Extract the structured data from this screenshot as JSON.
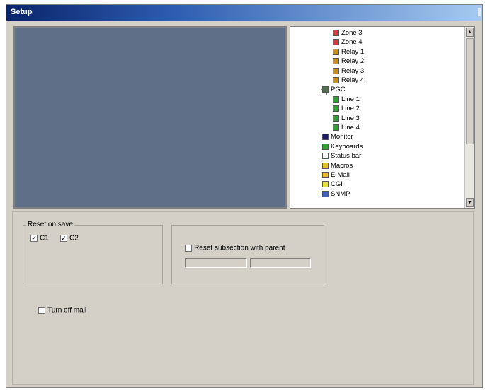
{
  "window": {
    "title": "Setup"
  },
  "tree": {
    "items": [
      {
        "label": "Zone 3",
        "icon": "zone-icon",
        "color": "#c84040",
        "indent": 2
      },
      {
        "label": "Zone 4",
        "icon": "zone-icon",
        "color": "#c84040",
        "indent": 2
      },
      {
        "label": "Relay 1",
        "icon": "relay-icon",
        "color": "#c89020",
        "indent": 2
      },
      {
        "label": "Relay 2",
        "icon": "relay-icon",
        "color": "#c89020",
        "indent": 2
      },
      {
        "label": "Relay 3",
        "icon": "relay-icon",
        "color": "#c89020",
        "indent": 2
      },
      {
        "label": "Relay 4",
        "icon": "relay-icon",
        "color": "#c89020",
        "indent": 2
      },
      {
        "label": "PGC",
        "icon": "pgc-icon",
        "color": "#507050",
        "indent": 1
      },
      {
        "label": "Line 1",
        "icon": "line-icon",
        "color": "#30a030",
        "indent": 2
      },
      {
        "label": "Line 2",
        "icon": "line-icon",
        "color": "#30a030",
        "indent": 2
      },
      {
        "label": "Line 3",
        "icon": "line-icon",
        "color": "#30a030",
        "indent": 2
      },
      {
        "label": "Line 4",
        "icon": "line-icon",
        "color": "#30a030",
        "indent": 2
      },
      {
        "label": "Monitor",
        "icon": "monitor-icon",
        "color": "#202060",
        "indent": 1
      },
      {
        "label": "Keyboards",
        "icon": "keyboard-icon",
        "color": "#30a030",
        "indent": 1
      },
      {
        "label": "Status bar",
        "icon": "statusbar-icon",
        "color": "#ffffff",
        "indent": 1
      },
      {
        "label": "Macros",
        "icon": "macro-icon",
        "color": "#e0c020",
        "indent": 1
      },
      {
        "label": "E-Mail",
        "icon": "email-icon",
        "color": "#e0c020",
        "indent": 1
      },
      {
        "label": "CGI",
        "icon": "cgi-icon",
        "color": "#e0e040",
        "indent": 1
      },
      {
        "label": "SNMP",
        "icon": "snmp-icon",
        "color": "#4060c0",
        "indent": 1
      }
    ]
  },
  "panel": {
    "reset_group_caption": "Reset on save",
    "option_c1": "C1",
    "option_c1_checked": true,
    "option_c2": "C2",
    "option_c2_checked": true,
    "reset_only_label": "Reset subsection with parent",
    "reset_only_checked": false,
    "turn_off_label": "Turn off mail",
    "turn_off_checked": false
  }
}
